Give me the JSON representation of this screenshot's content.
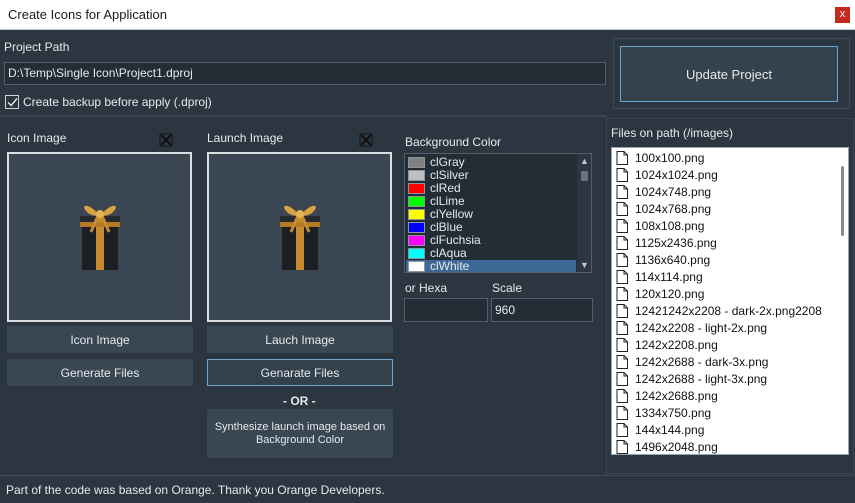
{
  "window": {
    "title": "Create Icons for Application",
    "close_glyph": "x"
  },
  "project": {
    "path_label": "Project Path",
    "path_value": "D:\\Temp\\Single Icon\\Project1.dproj",
    "backup_label": "Create backup before apply (.dproj)",
    "backup_checked": true,
    "update_button": "Update Project"
  },
  "icon_panel": {
    "label": "Icon Image",
    "image_button": "Icon Image",
    "generate_button": "Generate Files"
  },
  "launch_panel": {
    "label": "Launch Image",
    "image_button": "Lauch Image",
    "generate_button": "Genarate Files",
    "or_text": "- OR -",
    "synth_button": "Synthesize launch image based on Background Color"
  },
  "background": {
    "label": "Background Color",
    "colors": [
      {
        "name": "clGray",
        "hex": "#808080"
      },
      {
        "name": "clSilver",
        "hex": "#c0c0c0"
      },
      {
        "name": "clRed",
        "hex": "#ff0000"
      },
      {
        "name": "clLime",
        "hex": "#00ff00"
      },
      {
        "name": "clYellow",
        "hex": "#ffff00"
      },
      {
        "name": "clBlue",
        "hex": "#0000ff"
      },
      {
        "name": "clFuchsia",
        "hex": "#ff00ff"
      },
      {
        "name": "clAqua",
        "hex": "#00ffff"
      },
      {
        "name": "clWhite",
        "hex": "#ffffff"
      }
    ],
    "selected": "clWhite",
    "hexa_label": "or Hexa",
    "hexa_value": "",
    "scale_label": "Scale",
    "scale_value": "960"
  },
  "files": {
    "label": "Files on path (/images)",
    "items": [
      "100x100.png",
      "1024x1024.png",
      "1024x748.png",
      "1024x768.png",
      "108x108.png",
      "1125x2436.png",
      "1136x640.png",
      "114x114.png",
      "120x120.png",
      "12421242x2208 - dark-2x.png2208",
      "1242x2208 - light-2x.png",
      "1242x2208.png",
      "1242x2688 - dark-3x.png",
      "1242x2688 - light-3x.png",
      "1242x2688.png",
      "1334x750.png",
      "144x144.png",
      "1496x2048.png"
    ]
  },
  "footer": {
    "text": "Part of the code was based on Orange. Thank you Orange Developers."
  },
  "icons": {
    "clear": "close-x-icon",
    "file": "document-icon",
    "preview": "gift-box-image",
    "check": "checkmark-icon"
  }
}
